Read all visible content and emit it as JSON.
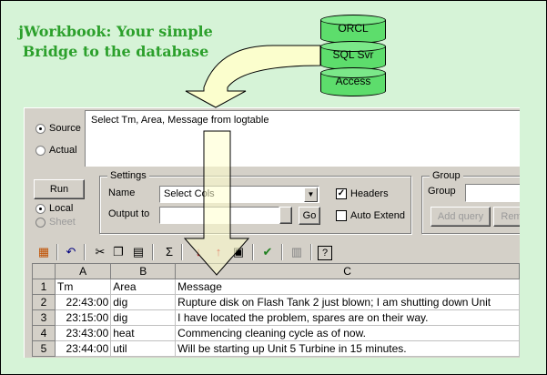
{
  "tagline": {
    "line1": "jWorkbook: Your simple",
    "line2": "Bridge to the database"
  },
  "databases": [
    "ORCL",
    "SQL Svr",
    "Access"
  ],
  "colors": {
    "background": "#d6f3d7",
    "tagline": "#2ca02c",
    "db_fill": "#5ddd6c",
    "arrow_fill": "#ffffcc"
  },
  "source": {
    "source_label": "Source",
    "actual_label": "Actual",
    "selected": "Source",
    "query": "Select Tm, Area, Message from logtable"
  },
  "run": {
    "run_label": "Run",
    "local_label": "Local",
    "sheet_label": "Sheet",
    "selected": "Local"
  },
  "settings": {
    "title": "Settings",
    "name_label": "Name",
    "name_value": "Select Cols",
    "output_label": "Output to",
    "output_value": "",
    "go_label": "Go",
    "headers_label": "Headers",
    "headers_checked": true,
    "auto_extend_label": "Auto Extend",
    "auto_extend_checked": false
  },
  "group": {
    "title": "Group",
    "group_label": "Group",
    "group_value": "",
    "add_query_label": "Add query",
    "remove_label": "Rem"
  },
  "toolbar": [
    "workbook-icon",
    "undo-icon",
    "cut-icon",
    "copy-icon",
    "paste-icon",
    "sum-icon",
    "sort-ascending-icon",
    "sort-descending-icon",
    "format-icon",
    "check-icon",
    "export-icon",
    "help-icon"
  ],
  "sheet": {
    "columns": [
      "A",
      "B",
      "C"
    ],
    "rows": [
      {
        "num": "1",
        "a": "Tm",
        "b": "Area",
        "c": "Message"
      },
      {
        "num": "2",
        "a": "22:43:00",
        "b": "dig",
        "c": "Rupture disk on Flash Tank 2 just blown; I am shutting down Unit"
      },
      {
        "num": "3",
        "a": "23:15:00",
        "b": "dig",
        "c": "I have located the problem, spares are on their way."
      },
      {
        "num": "4",
        "a": "23:43:00",
        "b": "heat",
        "c": "Commencing cleaning cycle as of now."
      },
      {
        "num": "5",
        "a": "23:44:00",
        "b": "util",
        "c": "Will be starting up Unit 5 Turbine in 15 minutes."
      }
    ]
  }
}
